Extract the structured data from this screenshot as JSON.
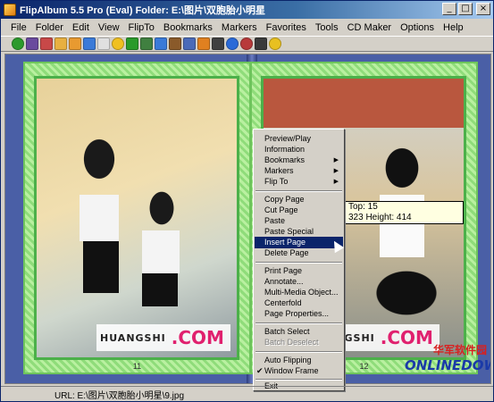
{
  "window": {
    "title": "FlipAlbum 5.5 Pro (Eval)    Folder: E:\\图片\\双胞胎小明星"
  },
  "menubar": {
    "items": [
      {
        "label": "File"
      },
      {
        "label": "Folder"
      },
      {
        "label": "Edit"
      },
      {
        "label": "View"
      },
      {
        "label": "FlipTo"
      },
      {
        "label": "Bookmarks"
      },
      {
        "label": "Markers"
      },
      {
        "label": "Favorites"
      },
      {
        "label": "Tools"
      },
      {
        "label": "CD Maker"
      },
      {
        "label": "Options"
      },
      {
        "label": "Help"
      }
    ]
  },
  "toolbar": {
    "tools": [
      {
        "icon": "green-circle-icon",
        "color": "#2c9a2c"
      },
      {
        "icon": "book-icon",
        "color": "#6a4a9e"
      },
      {
        "icon": "envelope-icon",
        "color": "#c84848"
      },
      {
        "icon": "folder-icon",
        "color": "#e8b040"
      },
      {
        "icon": "folder-open-icon",
        "color": "#e89a30"
      },
      {
        "icon": "image-icon",
        "color": "#3a7ad8"
      },
      {
        "icon": "page-icon",
        "color": "#e0e0e0"
      },
      {
        "icon": "sun-icon",
        "color": "#f0c020"
      },
      {
        "icon": "text-icon",
        "color": "#2a9a2a"
      },
      {
        "icon": "grid-icon",
        "color": "#408040"
      },
      {
        "icon": "pencil-icon",
        "color": "#3a7ad8"
      },
      {
        "icon": "brush-icon",
        "color": "#8a5a2a"
      },
      {
        "icon": "table-icon",
        "color": "#4a6ab8"
      },
      {
        "icon": "music-icon",
        "color": "#e08020"
      },
      {
        "icon": "film-icon",
        "color": "#404040"
      },
      {
        "icon": "globe-icon",
        "color": "#2a6ad8"
      },
      {
        "icon": "disc-icon",
        "color": "#b83a3a"
      },
      {
        "icon": "camera-icon",
        "color": "#3a3a3a"
      },
      {
        "icon": "help-icon",
        "color": "#e8c020"
      }
    ]
  },
  "album": {
    "left_page_number": "11",
    "right_page_number": "12",
    "watermark_text": "HUANGSHI",
    "watermark_com": ".COM"
  },
  "tooltip": {
    "line1": "Top: 15",
    "line2": "323 Height: 414"
  },
  "context_menu": {
    "items": [
      {
        "label": "Preview/Play"
      },
      {
        "label": "Information"
      },
      {
        "label": "Bookmarks",
        "submenu": "true"
      },
      {
        "label": "Markers",
        "submenu": "true"
      },
      {
        "label": "Flip To",
        "submenu": "true"
      },
      {
        "label": "Copy Page"
      },
      {
        "label": "Cut Page"
      },
      {
        "label": "Paste"
      },
      {
        "label": "Paste Special"
      },
      {
        "label": "Insert Page"
      },
      {
        "label": "Delete Page"
      },
      {
        "label": "Print Page"
      },
      {
        "label": "Annotate..."
      },
      {
        "label": "Multi-Media Object..."
      },
      {
        "label": "Centerfold"
      },
      {
        "label": "Page Properties..."
      },
      {
        "label": "Batch Select"
      },
      {
        "label": "Batch Deselect"
      },
      {
        "label": "Auto Flipping"
      },
      {
        "label": "Window Frame"
      },
      {
        "label": "Exit"
      }
    ]
  },
  "watermark_logo": {
    "cn": "华军软件园",
    "en": "ONLINEDOWN"
  },
  "statusbar": {
    "url": "URL: E:\\图片\\双胞胎小明星\\9.jpg"
  }
}
